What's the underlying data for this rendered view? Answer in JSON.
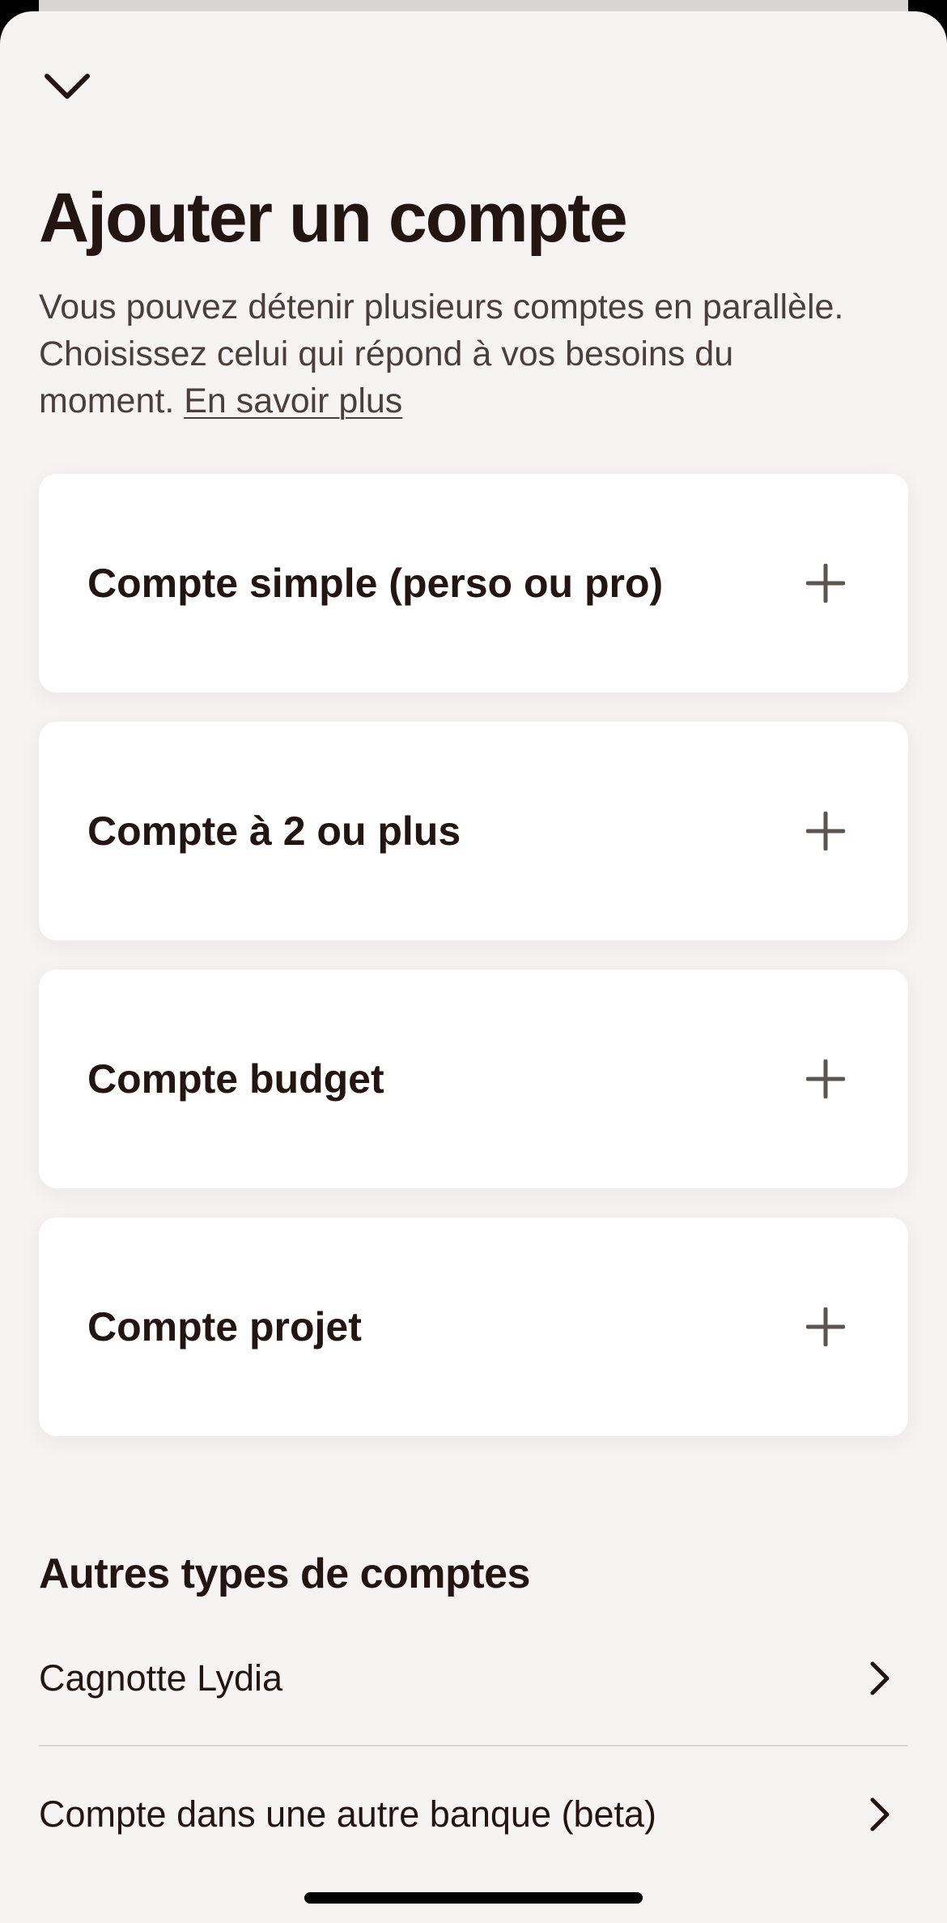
{
  "header": {
    "close_icon": "chevron-down-icon",
    "title": "Ajouter un compte",
    "subtitle": "Vous pouvez détenir plusieurs comptes en parallèle. Choisissez celui qui répond à vos besoins du moment. ",
    "learn_more_link": "En savoir plus"
  },
  "account_types": [
    {
      "label": "Compte simple (perso ou pro)",
      "icon": "plus-icon"
    },
    {
      "label": "Compte à 2 ou plus",
      "icon": "plus-icon"
    },
    {
      "label": "Compte budget",
      "icon": "plus-icon"
    },
    {
      "label": "Compte projet",
      "icon": "plus-icon"
    }
  ],
  "other_types": {
    "title": "Autres types de comptes",
    "items": [
      {
        "label": "Cagnotte Lydia",
        "icon": "chevron-right-icon"
      },
      {
        "label": "Compte dans une autre banque (beta)",
        "icon": "chevron-right-icon"
      }
    ]
  },
  "colors": {
    "background": "#f6f3f2",
    "card": "#ffffff",
    "text_primary": "#231512",
    "text_secondary": "#4a3f3c",
    "icon": "#5e5552"
  }
}
